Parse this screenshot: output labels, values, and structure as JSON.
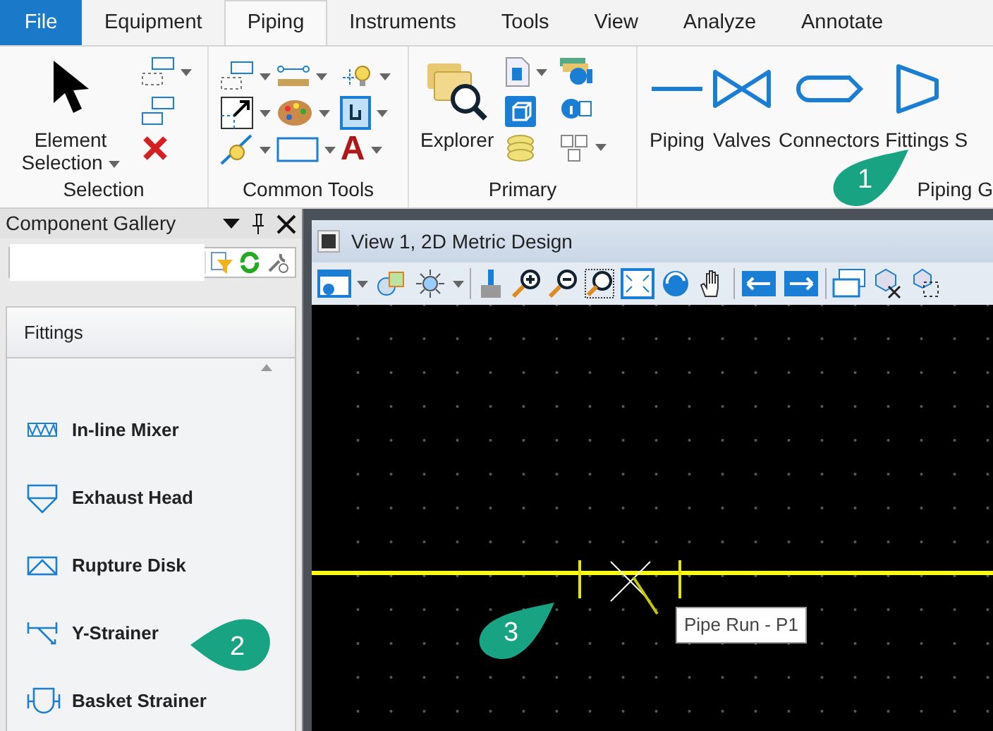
{
  "menu_tabs": [
    {
      "label": "File",
      "kind": "file",
      "selected": false
    },
    {
      "label": "Equipment",
      "kind": "tab",
      "selected": false
    },
    {
      "label": "Piping",
      "kind": "tab",
      "selected": true
    },
    {
      "label": "Instruments",
      "kind": "tab",
      "selected": false
    },
    {
      "label": "Tools",
      "kind": "tab",
      "selected": false
    },
    {
      "label": "View",
      "kind": "tab",
      "selected": false
    },
    {
      "label": "Analyze",
      "kind": "tab",
      "selected": false
    },
    {
      "label": "Annotate",
      "kind": "tab",
      "selected": false
    }
  ],
  "ribbon": {
    "selection": {
      "label": "Selection",
      "tool": "Element",
      "tool_line2": "Selection"
    },
    "common_tools": {
      "label": "Common Tools",
      "text_tool_glyph": "A"
    },
    "primary": {
      "label": "Primary",
      "tool": "Explorer"
    },
    "piping": {
      "label": "Piping G",
      "buttons": [
        {
          "label": "Piping",
          "kind": "line"
        },
        {
          "label": "Valves",
          "kind": "valve"
        },
        {
          "label": "Connectors",
          "kind": "connector"
        },
        {
          "label": "Fittings",
          "kind": "fitting"
        },
        {
          "label": "S",
          "kind": "none"
        }
      ]
    }
  },
  "gallery": {
    "title": "Component Gallery",
    "section": "Fittings",
    "items": [
      {
        "label": "In-line Mixer",
        "kind": "mixer"
      },
      {
        "label": "Exhaust Head",
        "kind": "exhaust"
      },
      {
        "label": "Rupture Disk",
        "kind": "rupture"
      },
      {
        "label": "Y-Strainer",
        "kind": "ystrainer"
      },
      {
        "label": "Basket Strainer",
        "kind": "basket"
      }
    ]
  },
  "view": {
    "title": "View 1, 2D Metric Design",
    "tooltip": "Pipe Run - P1"
  },
  "callouts": [
    {
      "label": "1"
    },
    {
      "label": "2"
    },
    {
      "label": "3"
    }
  ]
}
